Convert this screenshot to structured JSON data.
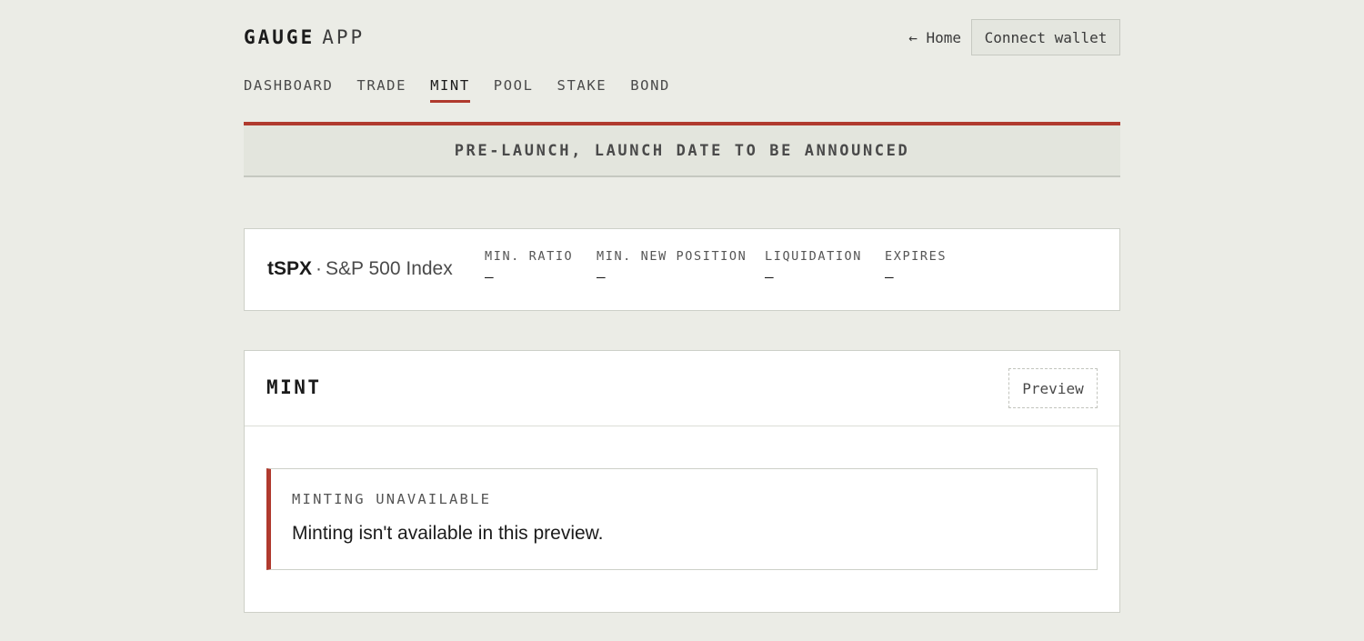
{
  "header": {
    "brand_primary": "GAUGE",
    "brand_secondary": "APP",
    "home_link": "← Home",
    "connect_wallet": "Connect wallet"
  },
  "nav": {
    "items": [
      "DASHBOARD",
      "TRADE",
      "MINT",
      "POOL",
      "STAKE",
      "BOND"
    ],
    "active": "MINT"
  },
  "banner": {
    "text": "PRE-LAUNCH, LAUNCH DATE TO BE ANNOUNCED"
  },
  "asset": {
    "symbol": "tSPX",
    "separator": "·",
    "name": "S&P 500 Index",
    "stats": [
      {
        "label": "MIN. RATIO",
        "value": "—"
      },
      {
        "label": "MIN. NEW POSITION",
        "value": "—"
      },
      {
        "label": "LIQUIDATION",
        "value": "—"
      },
      {
        "label": "EXPIRES",
        "value": "—"
      }
    ]
  },
  "mint": {
    "title": "MINT",
    "badge": "Preview",
    "notice_label": "MINTING UNAVAILABLE",
    "notice_text": "Minting isn't available in this preview."
  },
  "colors": {
    "accent": "#b03a2e",
    "background": "#ebece6",
    "panel": "#ffffff"
  }
}
